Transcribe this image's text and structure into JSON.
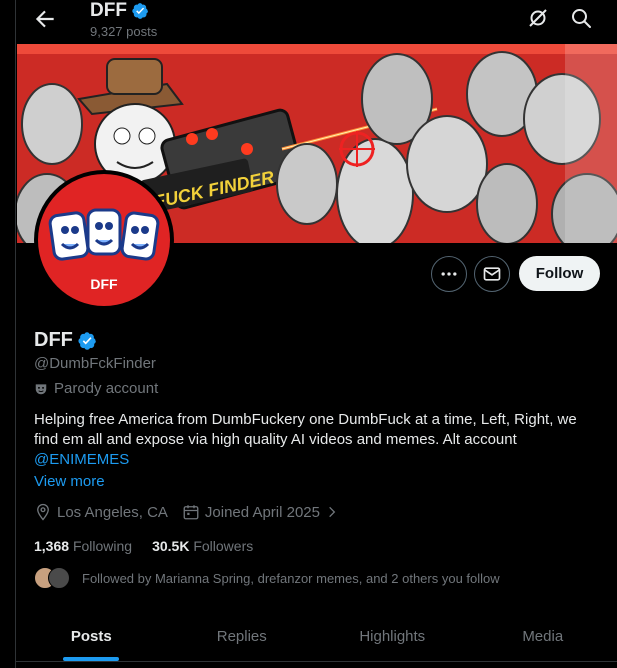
{
  "header": {
    "title": "DFF",
    "posts_count": "9,327 posts"
  },
  "banner": {
    "sign_text": "FUCK FINDER"
  },
  "avatar": {
    "letters": "DFF"
  },
  "actions": {
    "follow_label": "Follow"
  },
  "profile": {
    "name": "DFF",
    "handle": "@DumbFckFinder",
    "label": "Parody account",
    "bio": "Helping free America from DumbFuckery one DumbFuck at a time, Left, Right, we find em all and expose via high quality AI videos and memes. Alt account",
    "bio_mention": "@ENIMEMES",
    "view_more": "View more",
    "location": "Los Angeles, CA",
    "joined": "Joined April 2025",
    "following_count": "1,368",
    "following_label": "Following",
    "followers_count": "30.5K",
    "followers_label": "Followers",
    "followed_by": "Followed by Marianna Spring, drefanzor memes, and 2 others you follow"
  },
  "tabs": [
    {
      "label": "Posts"
    },
    {
      "label": "Replies"
    },
    {
      "label": "Highlights"
    },
    {
      "label": "Media"
    }
  ],
  "colors": {
    "accent": "#1d9bf0",
    "background": "#000000",
    "avatar_red": "#e02424"
  }
}
